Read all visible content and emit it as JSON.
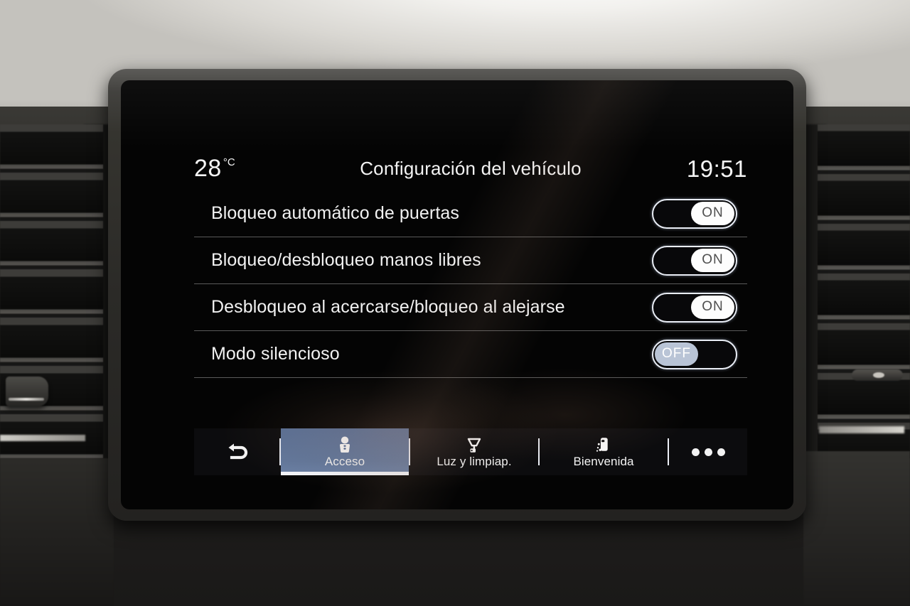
{
  "status_bar": {
    "temperature": "28",
    "temperature_unit": "°C",
    "title": "Configuración del vehículo",
    "clock": "19:51"
  },
  "settings_rows": [
    {
      "label": "Bloqueo automático de puertas",
      "state": "ON",
      "on": true
    },
    {
      "label": "Bloqueo/desbloqueo manos libres",
      "state": "ON",
      "on": true
    },
    {
      "label": "Desbloqueo al acercarse/bloqueo al alejarse",
      "state": "ON",
      "on": true
    },
    {
      "label": "Modo silencioso",
      "state": "OFF",
      "on": false
    }
  ],
  "tab_bar": {
    "back_icon": "back-arrow-icon",
    "tabs": [
      {
        "label": "Acceso",
        "icon": "key-fob-icon",
        "active": true
      },
      {
        "label": "Luz y limpiap.",
        "icon": "wiper-light-icon",
        "active": false
      },
      {
        "label": "Bienvenida",
        "icon": "welcome-car-light-icon",
        "active": false
      }
    ],
    "more_label": "•••",
    "more_icon": "more-options-icon"
  },
  "hardware_buttons": [
    {
      "icon": "power-icon",
      "name": "power-button"
    },
    {
      "icon": "apps-grid-icon",
      "name": "apps-button"
    },
    {
      "icon": "home-icon",
      "name": "home-button"
    },
    {
      "icon": "vehicle-settings-icon",
      "name": "vehicle-settings-button"
    },
    {
      "icon": "volume-speaker-icon",
      "name": "volume-button"
    }
  ],
  "colors": {
    "accent_tab": "#5a7198",
    "screen_background": "#040404",
    "text_primary": "#f2f2f2",
    "toggle_border": "#e9edf5",
    "toggle_off_knob": "#b9c4d6"
  }
}
